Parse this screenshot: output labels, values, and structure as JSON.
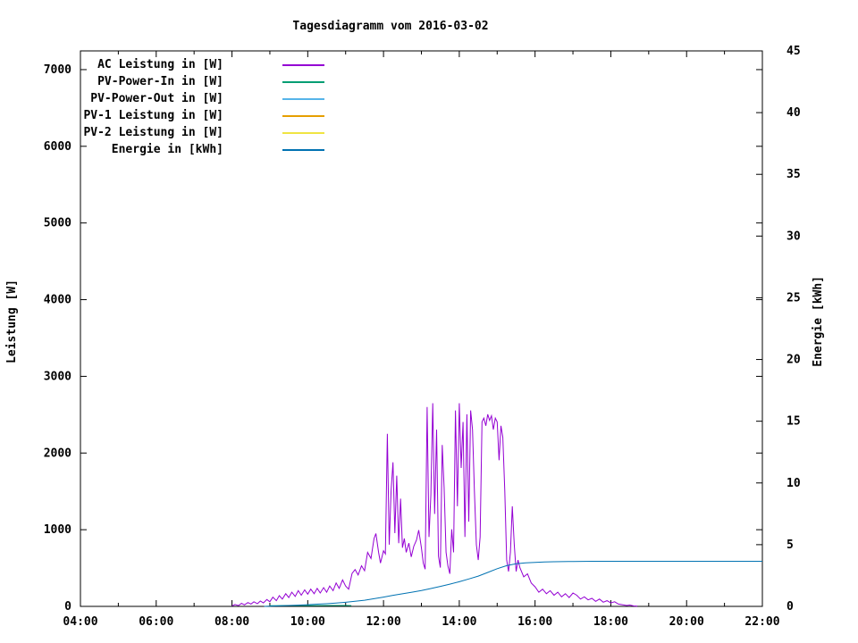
{
  "chart_data": {
    "type": "line",
    "title": "Tagesdiagramm vom 2016-03-02",
    "grid": false,
    "legend_position": "top-left-inside",
    "x_axis": {
      "min": 4,
      "max": 22,
      "major_ticks": [
        4,
        6,
        8,
        10,
        12,
        14,
        16,
        18,
        20,
        22
      ],
      "minor_ticks": [
        5,
        7,
        9,
        11,
        13,
        15,
        17,
        19,
        21
      ],
      "tick_labels": [
        "04:00",
        "06:00",
        "08:00",
        "10:00",
        "12:00",
        "14:00",
        "16:00",
        "18:00",
        "20:00",
        "22:00"
      ]
    },
    "y1_axis": {
      "label": "Leistung [W]",
      "min": 0,
      "max": 7244,
      "ticks": [
        0,
        1000,
        2000,
        3000,
        4000,
        5000,
        6000,
        7000
      ]
    },
    "y2_axis": {
      "label": "Energie [kWh]",
      "min": 0,
      "max": 45,
      "ticks": [
        0,
        5,
        10,
        15,
        20,
        25,
        30,
        35,
        40,
        45
      ]
    },
    "series": [
      {
        "name": "AC Leistung in [W]",
        "color": "#9400d3",
        "axis": "y1",
        "points": [
          [
            8.0,
            5
          ],
          [
            8.08,
            25
          ],
          [
            8.17,
            10
          ],
          [
            8.25,
            40
          ],
          [
            8.33,
            20
          ],
          [
            8.42,
            50
          ],
          [
            8.5,
            30
          ],
          [
            8.58,
            60
          ],
          [
            8.67,
            35
          ],
          [
            8.75,
            70
          ],
          [
            8.83,
            45
          ],
          [
            8.92,
            90
          ],
          [
            9.0,
            60
          ],
          [
            9.08,
            120
          ],
          [
            9.17,
            75
          ],
          [
            9.25,
            140
          ],
          [
            9.33,
            95
          ],
          [
            9.42,
            165
          ],
          [
            9.5,
            115
          ],
          [
            9.58,
            185
          ],
          [
            9.67,
            130
          ],
          [
            9.75,
            205
          ],
          [
            9.83,
            145
          ],
          [
            9.92,
            215
          ],
          [
            10.0,
            160
          ],
          [
            10.08,
            225
          ],
          [
            10.17,
            165
          ],
          [
            10.25,
            235
          ],
          [
            10.33,
            175
          ],
          [
            10.42,
            245
          ],
          [
            10.5,
            185
          ],
          [
            10.58,
            265
          ],
          [
            10.67,
            205
          ],
          [
            10.75,
            305
          ],
          [
            10.83,
            235
          ],
          [
            10.92,
            345
          ],
          [
            11.0,
            265
          ],
          [
            11.08,
            225
          ],
          [
            11.17,
            430
          ],
          [
            11.25,
            480
          ],
          [
            11.33,
            410
          ],
          [
            11.42,
            530
          ],
          [
            11.5,
            465
          ],
          [
            11.58,
            705
          ],
          [
            11.67,
            625
          ],
          [
            11.75,
            885
          ],
          [
            11.8,
            950
          ],
          [
            11.87,
            705
          ],
          [
            11.92,
            565
          ],
          [
            12.0,
            725
          ],
          [
            12.05,
            685
          ],
          [
            12.1,
            2250
          ],
          [
            12.15,
            805
          ],
          [
            12.2,
            1510
          ],
          [
            12.25,
            1880
          ],
          [
            12.3,
            955
          ],
          [
            12.35,
            1705
          ],
          [
            12.4,
            825
          ],
          [
            12.45,
            1405
          ],
          [
            12.5,
            765
          ],
          [
            12.55,
            885
          ],
          [
            12.6,
            705
          ],
          [
            12.67,
            825
          ],
          [
            12.73,
            645
          ],
          [
            12.8,
            785
          ],
          [
            12.87,
            865
          ],
          [
            12.93,
            995
          ],
          [
            13.0,
            765
          ],
          [
            13.05,
            565
          ],
          [
            13.1,
            485
          ],
          [
            13.15,
            2600
          ],
          [
            13.2,
            905
          ],
          [
            13.25,
            1455
          ],
          [
            13.3,
            2650
          ],
          [
            13.35,
            1205
          ],
          [
            13.4,
            2305
          ],
          [
            13.45,
            655
          ],
          [
            13.5,
            505
          ],
          [
            13.55,
            2105
          ],
          [
            13.6,
            1555
          ],
          [
            13.65,
            705
          ],
          [
            13.7,
            525
          ],
          [
            13.75,
            425
          ],
          [
            13.8,
            1005
          ],
          [
            13.85,
            705
          ],
          [
            13.9,
            2555
          ],
          [
            13.95,
            1305
          ],
          [
            14.0,
            2650
          ],
          [
            14.05,
            1805
          ],
          [
            14.1,
            2405
          ],
          [
            14.15,
            905
          ],
          [
            14.2,
            2505
          ],
          [
            14.25,
            1105
          ],
          [
            14.3,
            2555
          ],
          [
            14.35,
            2305
          ],
          [
            14.4,
            1505
          ],
          [
            14.45,
            805
          ],
          [
            14.5,
            605
          ],
          [
            14.55,
            905
          ],
          [
            14.6,
            2405
          ],
          [
            14.65,
            2455
          ],
          [
            14.7,
            2355
          ],
          [
            14.75,
            2505
          ],
          [
            14.8,
            2425
          ],
          [
            14.85,
            2485
          ],
          [
            14.9,
            2305
          ],
          [
            14.95,
            2455
          ],
          [
            15.0,
            2405
          ],
          [
            15.05,
            1905
          ],
          [
            15.1,
            2355
          ],
          [
            15.15,
            2205
          ],
          [
            15.2,
            1505
          ],
          [
            15.25,
            605
          ],
          [
            15.3,
            455
          ],
          [
            15.35,
            705
          ],
          [
            15.4,
            1305
          ],
          [
            15.45,
            805
          ],
          [
            15.5,
            455
          ],
          [
            15.55,
            605
          ],
          [
            15.6,
            505
          ],
          [
            15.7,
            385
          ],
          [
            15.8,
            425
          ],
          [
            15.9,
            305
          ],
          [
            16.0,
            255
          ],
          [
            16.1,
            185
          ],
          [
            16.2,
            225
          ],
          [
            16.3,
            165
          ],
          [
            16.4,
            205
          ],
          [
            16.5,
            145
          ],
          [
            16.6,
            185
          ],
          [
            16.7,
            125
          ],
          [
            16.8,
            165
          ],
          [
            16.9,
            115
          ],
          [
            17.0,
            175
          ],
          [
            17.1,
            145
          ],
          [
            17.2,
            95
          ],
          [
            17.3,
            125
          ],
          [
            17.4,
            85
          ],
          [
            17.5,
            105
          ],
          [
            17.6,
            65
          ],
          [
            17.7,
            95
          ],
          [
            17.8,
            55
          ],
          [
            17.9,
            75
          ],
          [
            18.0,
            45
          ],
          [
            18.1,
            60
          ],
          [
            18.2,
            30
          ],
          [
            18.3,
            22
          ],
          [
            18.42,
            12
          ],
          [
            18.5,
            18
          ],
          [
            18.6,
            6
          ],
          [
            18.7,
            2
          ]
        ]
      },
      {
        "name": "PV-Power-In in [W]",
        "color": "#009e73",
        "axis": "y1",
        "points": [
          [
            9.0,
            8
          ],
          [
            9.5,
            10
          ],
          [
            10.0,
            10
          ],
          [
            10.5,
            12
          ],
          [
            11.0,
            12
          ],
          [
            11.15,
            10
          ]
        ]
      },
      {
        "name": "PV-Power-Out in [W]",
        "color": "#56b4e9",
        "axis": "y1",
        "points": []
      },
      {
        "name": "PV-1 Leistung in [W]",
        "color": "#e69f00",
        "axis": "y1",
        "points": []
      },
      {
        "name": "PV-2 Leistung in [W]",
        "color": "#f0e442",
        "axis": "y1",
        "points": []
      },
      {
        "name": "Energie in [kWh]",
        "color": "#0072b2",
        "axis": "y2",
        "points": [
          [
            8.85,
            0
          ],
          [
            9.0,
            0.02
          ],
          [
            9.25,
            0.04
          ],
          [
            9.5,
            0.07
          ],
          [
            9.75,
            0.1
          ],
          [
            10.0,
            0.14
          ],
          [
            10.25,
            0.18
          ],
          [
            10.5,
            0.22
          ],
          [
            10.75,
            0.27
          ],
          [
            11.0,
            0.33
          ],
          [
            11.25,
            0.41
          ],
          [
            11.5,
            0.5
          ],
          [
            11.75,
            0.62
          ],
          [
            12.0,
            0.75
          ],
          [
            12.25,
            0.9
          ],
          [
            12.5,
            1.02
          ],
          [
            12.75,
            1.15
          ],
          [
            13.0,
            1.28
          ],
          [
            13.25,
            1.45
          ],
          [
            13.5,
            1.62
          ],
          [
            13.75,
            1.8
          ],
          [
            14.0,
            2.0
          ],
          [
            14.25,
            2.22
          ],
          [
            14.5,
            2.45
          ],
          [
            14.75,
            2.75
          ],
          [
            15.0,
            3.05
          ],
          [
            15.25,
            3.3
          ],
          [
            15.5,
            3.45
          ],
          [
            15.75,
            3.52
          ],
          [
            16.0,
            3.56
          ],
          [
            16.25,
            3.6
          ],
          [
            16.5,
            3.62
          ],
          [
            17.0,
            3.64
          ],
          [
            17.5,
            3.65
          ],
          [
            22.0,
            3.65
          ]
        ]
      }
    ]
  }
}
